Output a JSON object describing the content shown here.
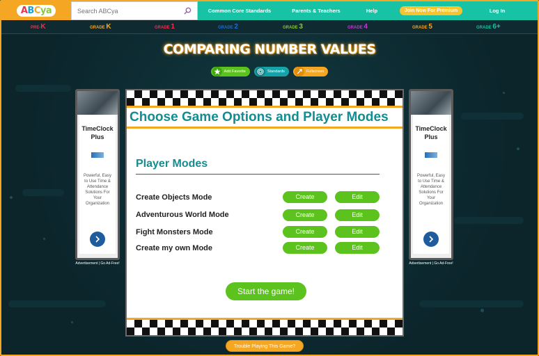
{
  "header": {
    "logo_text": "ABCya",
    "search_placeholder": "Search ABCya",
    "nav": [
      "Common Core Standards",
      "Parents & Teachers",
      "Help"
    ],
    "premium_button": "Join Now For Premium",
    "login": "Log In"
  },
  "grades": [
    {
      "prefix": "PRE-",
      "big": "K",
      "color": "#e8344e"
    },
    {
      "prefix": "GRADE ",
      "big": "K",
      "color": "#f5a623"
    },
    {
      "prefix": "GRADE ",
      "big": "1",
      "color": "#e8344e"
    },
    {
      "prefix": "GRADE ",
      "big": "2",
      "color": "#1a6fd0"
    },
    {
      "prefix": "GRADE ",
      "big": "3",
      "color": "#8dc63f"
    },
    {
      "prefix": "GRADE ",
      "big": "4",
      "color": "#c13ad6"
    },
    {
      "prefix": "GRADE ",
      "big": "5",
      "color": "#f5a623"
    },
    {
      "prefix": "GRADE ",
      "big": "6+",
      "color": "#17c3a4"
    }
  ],
  "page_title": "COMPARING NUMBER VALUES",
  "actions": {
    "favorite": "Add Favorite",
    "standards": "Standards",
    "fullscreen": "Fullscreen"
  },
  "ad": {
    "brand": "TimeClock Plus",
    "desc": "Powerful, Easy to Use Time & Attendance Solutions For Your Organization",
    "note": "Advertisement | Go Ad-Free!"
  },
  "game": {
    "title": "Choose Game Options and Player Modes",
    "section": "Player Modes",
    "modes": [
      {
        "label": "Create Objects Mode",
        "create": "Create",
        "edit": "Edit"
      },
      {
        "label": "Adventurous World Mode",
        "create": "Create",
        "edit": "Edit"
      },
      {
        "label": "Fight Monsters Mode",
        "create": "Create",
        "edit": "Edit"
      },
      {
        "label": "Create my own Mode",
        "create": "Create",
        "edit": "Edit"
      }
    ],
    "start": "Start the game!"
  },
  "trouble": "Trouble Playing This Game?",
  "colors": {
    "teal": "#17c3a4",
    "orange": "#f5a623",
    "green": "#5cc21e",
    "heading": "#158c8f",
    "background": "#0c2a30"
  }
}
